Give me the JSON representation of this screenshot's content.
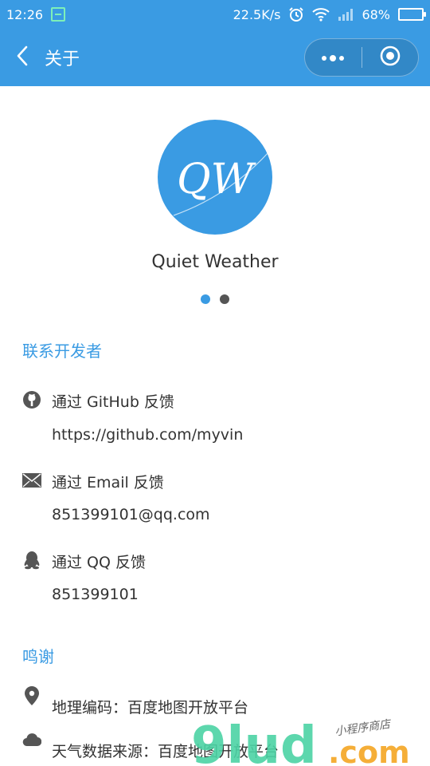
{
  "status_bar": {
    "time": "12:26",
    "speed": "22.5K/s",
    "battery": "68%",
    "battery_level": 0.68
  },
  "nav": {
    "title": "关于"
  },
  "app": {
    "logo_text": "QW",
    "name": "Quiet Weather",
    "page_count": 2,
    "active_page": 1
  },
  "contact": {
    "heading": "联系开发者",
    "items": [
      {
        "icon": "github-icon",
        "title": "通过 GitHub 反馈",
        "value": "https://github.com/myvin"
      },
      {
        "icon": "email-icon",
        "title": "通过 Email 反馈",
        "value": "851399101@qq.com"
      },
      {
        "icon": "qq-icon",
        "title": "通过 QQ 反馈",
        "value": "851399101"
      }
    ]
  },
  "thanks": {
    "heading": "鸣谢",
    "items": [
      {
        "icon": "location-pin-icon",
        "title": "地理编码：百度地图开放平台"
      },
      {
        "icon": "cloud-icon",
        "title": "天气数据来源：百度地图开放平台"
      }
    ]
  },
  "watermark": {
    "brand": "9lud",
    "suffix": ".com",
    "tagline": "小程序商店"
  },
  "colors": {
    "primary": "#3a9be3",
    "watermark_green": "#4cd3a5",
    "watermark_orange": "#f5a623"
  }
}
